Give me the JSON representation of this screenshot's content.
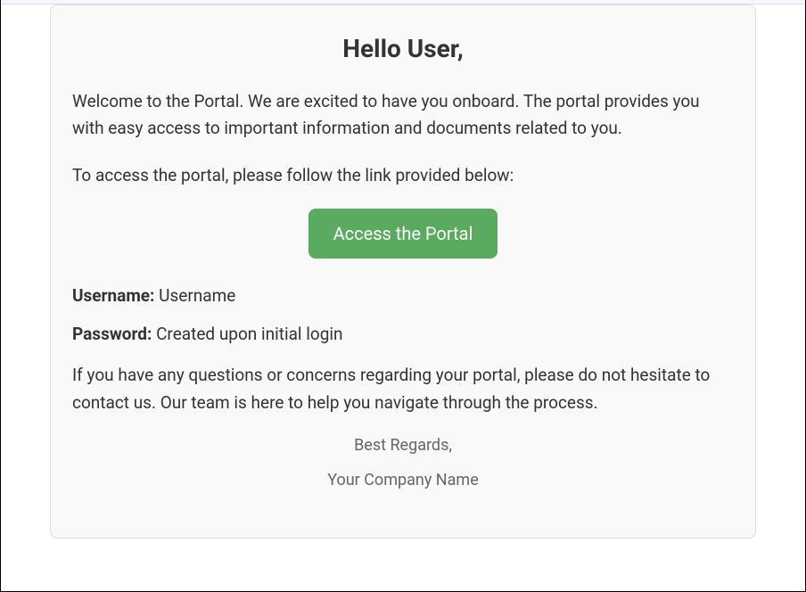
{
  "greeting": "Hello User,",
  "welcome_text": "Welcome to the Portal. We are excited to have you onboard. The portal provides you with easy access to important information and documents related to you.",
  "instruction_text": "To access the portal, please follow the link provided below:",
  "cta_label": "Access the Portal",
  "credentials": {
    "username_label": "Username:",
    "username_value": "Username",
    "password_label": "Password:",
    "password_value": "Created upon initial login"
  },
  "support_text": "If you have any questions or concerns regarding your portal, please do not hesitate to contact us. Our team is here to help you navigate through the process.",
  "signoff": "Best Regards,",
  "company": "Your Company Name"
}
